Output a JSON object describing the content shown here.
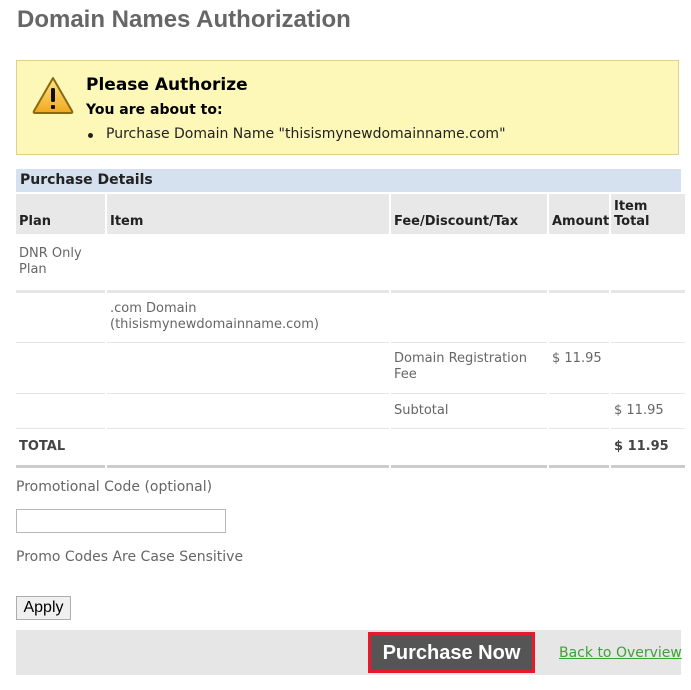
{
  "page": {
    "title": "Domain Names Authorization"
  },
  "alert": {
    "title": "Please Authorize",
    "subtitle": "You are about to:",
    "items": [
      "Purchase Domain Name \"thisismynewdomainname.com\""
    ]
  },
  "purchase_details": {
    "heading": "Purchase Details",
    "columns": [
      "Plan",
      "Item",
      "Fee/Discount/Tax",
      "Amount",
      "Item Total"
    ],
    "rows": [
      {
        "plan": "DNR Only Plan",
        "item": "",
        "fee": "",
        "amount": "",
        "total": ""
      },
      {
        "plan": "",
        "item": ".com Domain (thisismynewdomainname.com)",
        "fee": "",
        "amount": "",
        "total": ""
      },
      {
        "plan": "",
        "item": "",
        "fee": "Domain Registration Fee",
        "amount": "$ 11.95",
        "total": ""
      },
      {
        "plan": "",
        "item": "",
        "fee": "Subtotal",
        "amount": "",
        "total": "$ 11.95"
      }
    ],
    "total": {
      "label": "TOTAL",
      "value": "$ 11.95"
    }
  },
  "promo": {
    "label": "Promotional Code (optional)",
    "value": "",
    "hint": "Promo Codes Are Case Sensitive",
    "apply_label": "Apply"
  },
  "actions": {
    "purchase_label": "Purchase Now",
    "back_label": "Back to Overview"
  },
  "colors": {
    "alert_bg": "#fdf7b8",
    "section_bar": "#d5e1ef",
    "purchase_bg": "#555555",
    "purchase_outline": "#e8192b",
    "link": "#3ca335"
  },
  "icons": {
    "alert": "warning-triangle-icon"
  }
}
